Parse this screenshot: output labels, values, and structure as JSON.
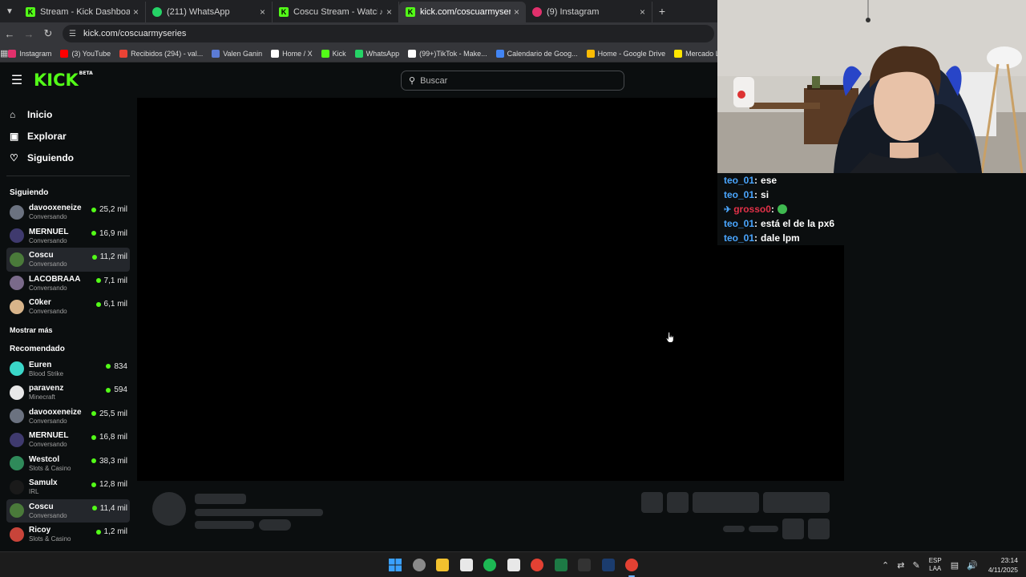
{
  "browser": {
    "tabs": [
      {
        "title": "Stream - Kick Dashboard",
        "active": false,
        "icon": "kick-icon",
        "color": "#53fc18"
      },
      {
        "title": "(211) WhatsApp",
        "active": false,
        "icon": "whatsapp-icon",
        "color": "#25d366"
      },
      {
        "title": "Coscu Stream - Watch Live",
        "active": false,
        "icon": "kick-icon",
        "color": "#53fc18"
      },
      {
        "title": "kick.com/coscuarmyseries",
        "active": true,
        "icon": "kick-icon",
        "color": "#53fc18"
      },
      {
        "title": "(9) Instagram",
        "active": false,
        "icon": "instagram-icon",
        "color": "#e1306c"
      }
    ],
    "url": "kick.com/coscuarmyseries",
    "bookmarks": [
      {
        "label": "Instagram",
        "color": "#e1306c"
      },
      {
        "label": "(3) YouTube",
        "color": "#ff0000"
      },
      {
        "label": "Recibidos (294) - val...",
        "color": "#ea4335"
      },
      {
        "label": "Valen Ganin",
        "color": "#5b7bd5"
      },
      {
        "label": "Home / X",
        "color": "#ffffff"
      },
      {
        "label": "Kick",
        "color": "#53fc18"
      },
      {
        "label": "WhatsApp",
        "color": "#25d366"
      },
      {
        "label": "(99+)TikTok - Make...",
        "color": "#ffffff"
      },
      {
        "label": "Calendario de Goog...",
        "color": "#4285f4"
      },
      {
        "label": "Home - Google Drive",
        "color": "#fbbc04"
      },
      {
        "label": "Mercado Libre Arge...",
        "color": "#ffe600"
      }
    ]
  },
  "kick": {
    "logo": "KICK",
    "logo_badge": "BETA",
    "search_placeholder": "Buscar",
    "nav": [
      {
        "label": "Inicio",
        "icon": "home-icon"
      },
      {
        "label": "Explorar",
        "icon": "compass-icon"
      },
      {
        "label": "Siguiendo",
        "icon": "heart-icon"
      }
    ],
    "following_title": "Siguiendo",
    "following": [
      {
        "name": "davooxeneize",
        "category": "Conversando",
        "viewers": "25,2 mil",
        "highlight": false,
        "avatar": "#6b7280"
      },
      {
        "name": "MERNUEL",
        "category": "Conversando",
        "viewers": "16,9 mil",
        "highlight": false,
        "avatar": "#3f3a6e"
      },
      {
        "name": "Coscu",
        "category": "Conversando",
        "viewers": "11,2 mil",
        "highlight": true,
        "avatar": "#4a7a3a"
      },
      {
        "name": "LACOBRAAA",
        "category": "Conversando",
        "viewers": "7,1 mil",
        "highlight": false,
        "avatar": "#7a6a8a"
      },
      {
        "name": "C0ker",
        "category": "Conversando",
        "viewers": "6,1 mil",
        "highlight": false,
        "avatar": "#d8b48a"
      }
    ],
    "show_more": "Mostrar más",
    "recommended_title": "Recomendado",
    "recommended": [
      {
        "name": "Euren",
        "category": "Blood Strike",
        "viewers": "834",
        "highlight": false,
        "avatar": "#3ad6c8"
      },
      {
        "name": "paravenz",
        "category": "Minecraft",
        "viewers": "594",
        "highlight": false,
        "avatar": "#e8e8e8"
      },
      {
        "name": "davooxeneize",
        "category": "Conversando",
        "viewers": "25,5 mil",
        "highlight": false,
        "avatar": "#6b7280"
      },
      {
        "name": "MERNUEL",
        "category": "Conversando",
        "viewers": "16,8 mil",
        "highlight": false,
        "avatar": "#3f3a6e"
      },
      {
        "name": "Westcol",
        "category": "Slots & Casino",
        "viewers": "38,3 mil",
        "highlight": false,
        "avatar": "#2f8a5a"
      },
      {
        "name": "Samulx",
        "category": "IRL",
        "viewers": "12,8 mil",
        "highlight": false,
        "avatar": "#1a1a1a"
      },
      {
        "name": "Coscu",
        "category": "Conversando",
        "viewers": "11,4 mil",
        "highlight": true,
        "avatar": "#4a7a3a"
      },
      {
        "name": "Ricoy",
        "category": "Slots & Casino",
        "viewers": "1,2 mil",
        "highlight": false,
        "avatar": "#c8443a"
      }
    ]
  },
  "chat": [
    {
      "user": "teo_01",
      "text": "ese",
      "color": "#4aa6ff",
      "badge": ""
    },
    {
      "user": "teo_01",
      "text": "si",
      "color": "#4aa6ff",
      "badge": ""
    },
    {
      "user": "grosso0",
      "text": "",
      "color": "#e23148",
      "badge": "pin-icon",
      "emote": "green-emote-icon"
    },
    {
      "user": "teo_01",
      "text": "está el de la px6",
      "color": "#4aa6ff",
      "badge": ""
    },
    {
      "user": "teo_01",
      "text": "dale lpm",
      "color": "#4aa6ff",
      "badge": ""
    }
  ],
  "taskbar": {
    "apps": [
      "windows-start-icon",
      "copilot-icon",
      "file-explorer-icon",
      "store-icon",
      "spotify-icon",
      "capcut-icon",
      "chrome-icon",
      "excel-icon",
      "epic-games-icon",
      "steam-icon",
      "chrome-active-icon"
    ],
    "lang_top": "ESP",
    "lang_bottom": "LAA",
    "time": "23:14",
    "date": "4/11/2025"
  }
}
